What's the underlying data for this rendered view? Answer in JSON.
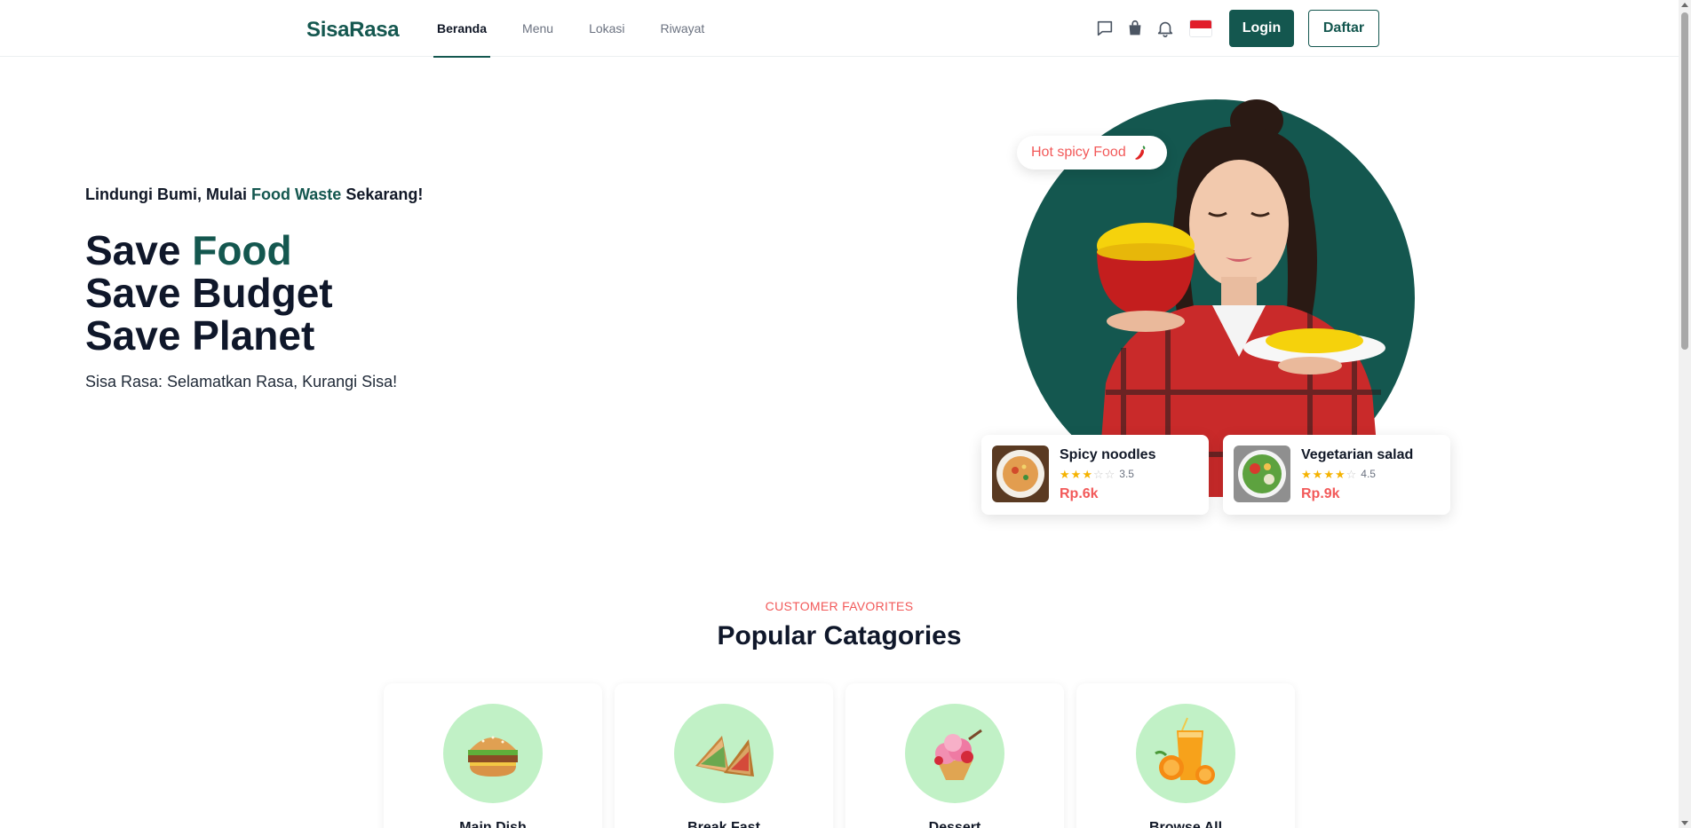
{
  "header": {
    "logo": "SisaRasa",
    "nav": [
      {
        "label": "Beranda",
        "active": true
      },
      {
        "label": "Menu",
        "active": false
      },
      {
        "label": "Lokasi",
        "active": false
      },
      {
        "label": "Riwayat",
        "active": false
      }
    ],
    "icons": [
      "chat-icon",
      "shopping-bag-icon",
      "bell-icon",
      "indonesia-flag-icon"
    ],
    "login_label": "Login",
    "daftar_label": "Daftar"
  },
  "hero": {
    "tagline_start": "Lindungi Bumi, Mulai ",
    "tagline_accent": "Food Waste",
    "tagline_end": " Sekarang!",
    "headline_1_start": "Save ",
    "headline_1_accent": "Food",
    "headline_2": "Save Budget",
    "headline_3": "Save Planet",
    "subtitle": "Sisa Rasa: Selamatkan Rasa, Kurangi Sisa!",
    "badge": "Hot spicy Food",
    "dishes": [
      {
        "name": "Spicy noodles",
        "rating": "3.5",
        "stars": 3.5,
        "price": "Rp.6k"
      },
      {
        "name": "Vegetarian salad",
        "rating": "4.5",
        "stars": 4.5,
        "price": "Rp.9k"
      }
    ]
  },
  "categories": {
    "kicker": "CUSTOMER FAVORITES",
    "title": "Popular Catagories",
    "items": [
      {
        "label": "Main Dish"
      },
      {
        "label": "Break Fast"
      },
      {
        "label": "Dessert"
      },
      {
        "label": "Browse All"
      }
    ]
  },
  "colors": {
    "brand": "#14574f",
    "accent_red": "#f25959",
    "category_bubble": "#c1f1c6",
    "star": "#f5b301"
  }
}
